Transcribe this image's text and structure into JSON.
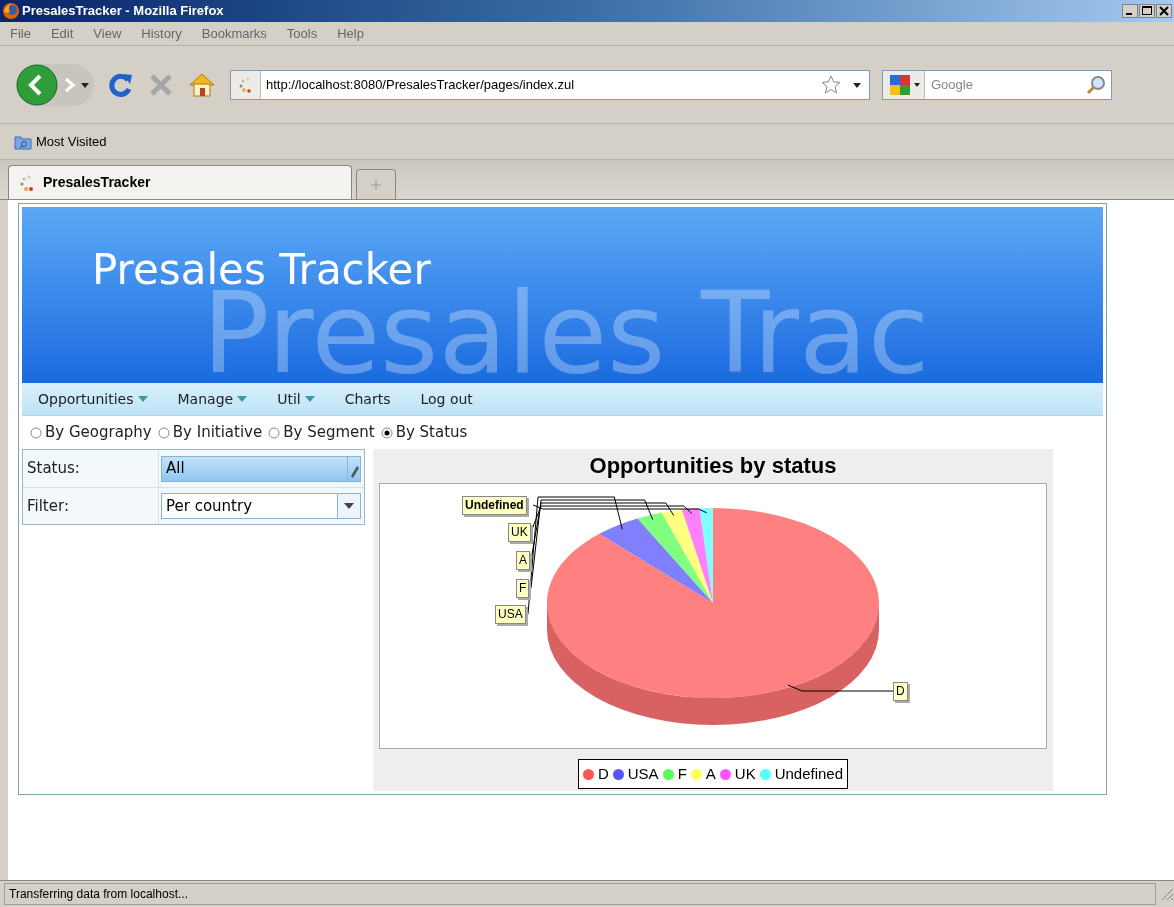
{
  "window": {
    "title": "PresalesTracker - Mozilla Firefox"
  },
  "menu_bar": [
    "File",
    "Edit",
    "View",
    "History",
    "Bookmarks",
    "Tools",
    "Help"
  ],
  "address_bar": {
    "url": "http://localhost:8080/PresalesTracker/pages/index.zul"
  },
  "search_field": {
    "placeholder": "Google"
  },
  "bookmarks": [
    "Most Visited"
  ],
  "tabs": [
    {
      "label": "PresalesTracker",
      "selected": true
    }
  ],
  "app": {
    "title": "Presales Tracker",
    "title_watermark": "Presales Trac",
    "menu": [
      {
        "label": "Opportunities",
        "dropdown": true
      },
      {
        "label": "Manage",
        "dropdown": true
      },
      {
        "label": "Util",
        "dropdown": true
      },
      {
        "label": "Charts",
        "dropdown": false
      },
      {
        "label": "Log out",
        "dropdown": false
      }
    ],
    "view_options": [
      {
        "label": "By Geography",
        "selected": false
      },
      {
        "label": "By Initiative",
        "selected": false
      },
      {
        "label": "By Segment",
        "selected": false
      },
      {
        "label": "By Status",
        "selected": true
      }
    ],
    "filters": [
      {
        "label": "Status:",
        "value": "All",
        "kind": "combobox"
      },
      {
        "label": "Filter:",
        "value": "Per country",
        "kind": "select"
      }
    ],
    "chart": {
      "title": "Opportunities by status",
      "slice_labels": [
        "Undefined",
        "UK",
        "A",
        "F",
        "USA",
        "D"
      ],
      "legend": [
        {
          "label": "D",
          "color": "#ff5555"
        },
        {
          "label": "USA",
          "color": "#5555ff"
        },
        {
          "label": "F",
          "color": "#55ff55"
        },
        {
          "label": "A",
          "color": "#ffff55"
        },
        {
          "label": "UK",
          "color": "#ff55ff"
        },
        {
          "label": "Undefined",
          "color": "#55ffff"
        }
      ]
    }
  },
  "status_bar": {
    "text": "Transferring data from localhost..."
  }
}
